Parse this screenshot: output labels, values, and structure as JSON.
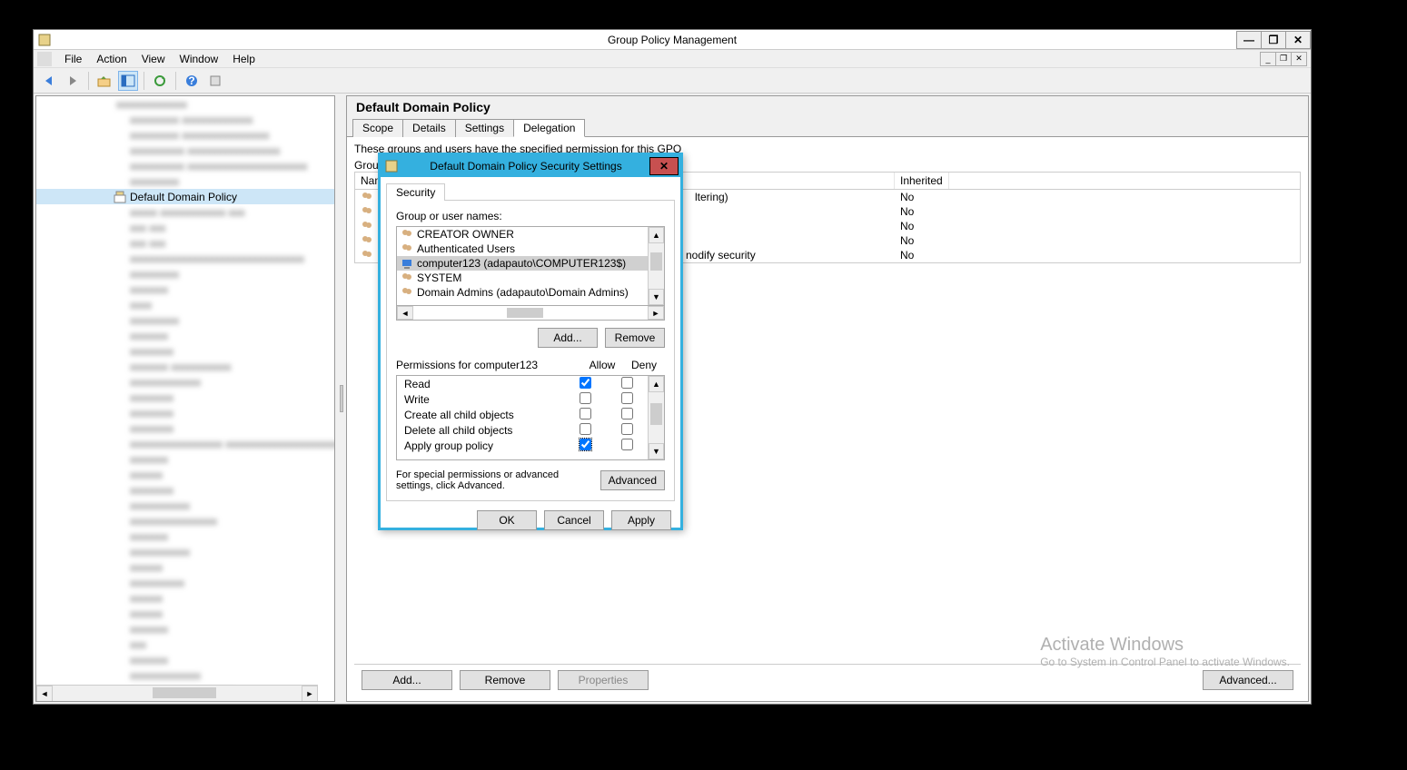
{
  "window": {
    "title": "Group Policy Management",
    "controls": {
      "min": "—",
      "max": "❐",
      "close": "✕"
    }
  },
  "menu": {
    "file": "File",
    "action": "Action",
    "view": "View",
    "window": "Window",
    "help": "Help",
    "inner": {
      "min": "_",
      "max": "❐",
      "close": "✕"
    }
  },
  "tree": {
    "selected": "Default Domain Policy"
  },
  "main": {
    "title": "Default Domain Policy",
    "tabs": {
      "scope": "Scope",
      "details": "Details",
      "settings": "Settings",
      "delegation": "Delegation"
    },
    "delegation": {
      "intro": "These groups and users have the specified permission for this GPO",
      "grouplabel": "Group",
      "cols": {
        "name": "Nam",
        "inherited": "Inherited"
      },
      "rows": [
        {
          "partial_right": "ltering)",
          "inherited": "No"
        },
        {
          "partial_right": "",
          "inherited": "No"
        },
        {
          "partial_right": "",
          "inherited": "No"
        },
        {
          "partial_right": "",
          "inherited": "No"
        },
        {
          "partial_right": "nodify security",
          "inherited": "No"
        }
      ],
      "buttons": {
        "add": "Add...",
        "remove": "Remove",
        "properties": "Properties",
        "advanced": "Advanced..."
      }
    }
  },
  "dialog": {
    "title": "Default Domain Policy Security Settings",
    "close": "✕",
    "tab": "Security",
    "group_label": "Group or user names:",
    "items": [
      {
        "label": "CREATOR OWNER",
        "icon": "group"
      },
      {
        "label": "Authenticated Users",
        "icon": "group"
      },
      {
        "label": "computer123 (adapauto\\COMPUTER123$)",
        "icon": "computer",
        "selected": true
      },
      {
        "label": "SYSTEM",
        "icon": "group"
      },
      {
        "label": "Domain Admins (adapauto\\Domain Admins)",
        "icon": "group"
      }
    ],
    "add": "Add...",
    "remove": "Remove",
    "perm_header": {
      "name": "Permissions for computer123",
      "allow": "Allow",
      "deny": "Deny"
    },
    "perms": [
      {
        "name": "Read",
        "allow": true,
        "deny": false
      },
      {
        "name": "Write",
        "allow": false,
        "deny": false
      },
      {
        "name": "Create all child objects",
        "allow": false,
        "deny": false
      },
      {
        "name": "Delete all child objects",
        "allow": false,
        "deny": false
      },
      {
        "name": "Apply group policy",
        "allow": true,
        "deny": false
      }
    ],
    "adv_text": "For special permissions or advanced settings, click Advanced.",
    "advanced": "Advanced",
    "ok": "OK",
    "cancel": "Cancel",
    "apply": "Apply"
  },
  "watermark": {
    "title": "Activate Windows",
    "sub": "Go to System in Control Panel to activate Windows."
  }
}
